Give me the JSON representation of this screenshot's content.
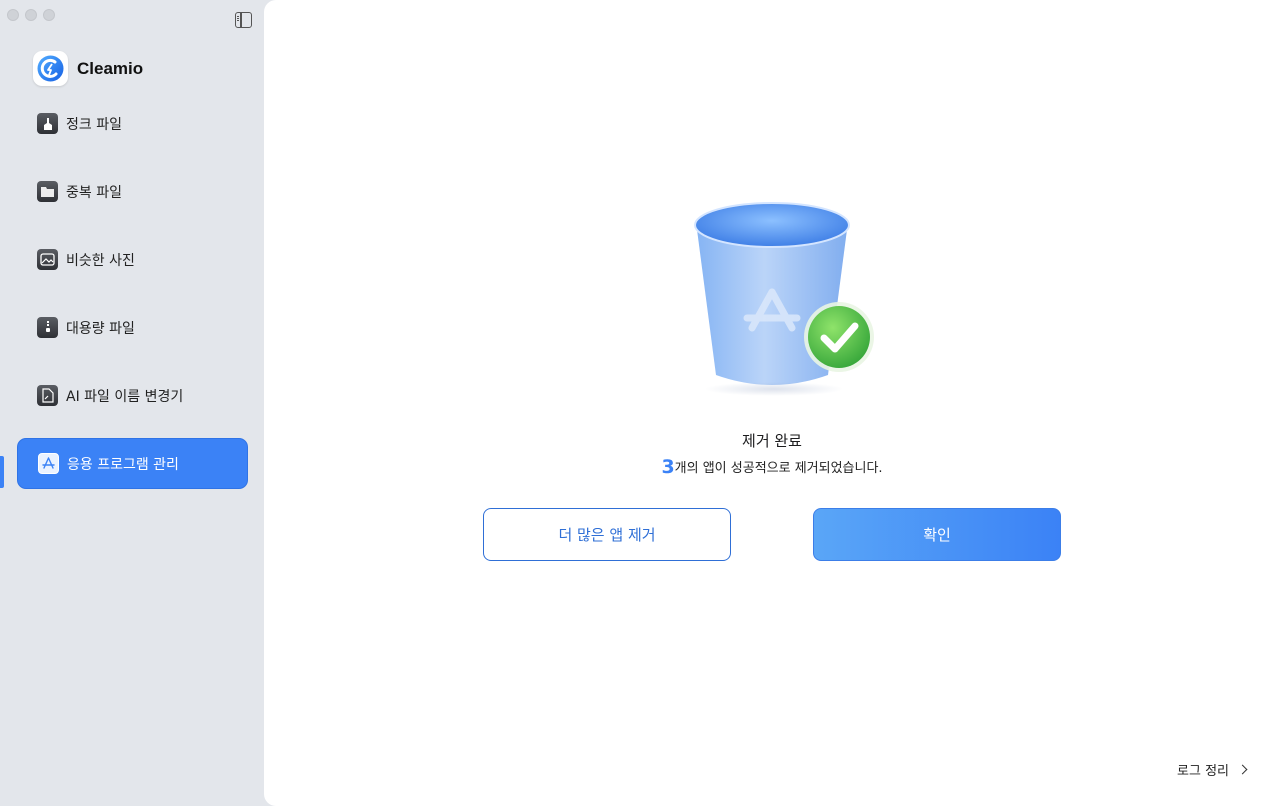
{
  "app": {
    "name": "Cleamio"
  },
  "sidebar": {
    "items": [
      {
        "label": "정크 파일",
        "icon": "broom-icon",
        "active": false
      },
      {
        "label": "중복 파일",
        "icon": "folder-icon",
        "active": false
      },
      {
        "label": "비슷한 사진",
        "icon": "photo-icon",
        "active": false
      },
      {
        "label": "대용량 파일",
        "icon": "zip-icon",
        "active": false
      },
      {
        "label": "AI 파일 이름 변경기",
        "icon": "document-icon",
        "active": false
      },
      {
        "label": "응용 프로그램 관리",
        "icon": "app-store-icon",
        "active": true
      }
    ]
  },
  "main": {
    "title": "제거 완료",
    "count": "3",
    "message": "개의 앱이 성공적으로 제거되었습니다.",
    "remove_more_label": "더 많은 앱 제거",
    "confirm_label": "확인",
    "log_cleanup_label": "로그 정리"
  },
  "colors": {
    "accent": "#3b82f6",
    "success": "#4caf50"
  }
}
